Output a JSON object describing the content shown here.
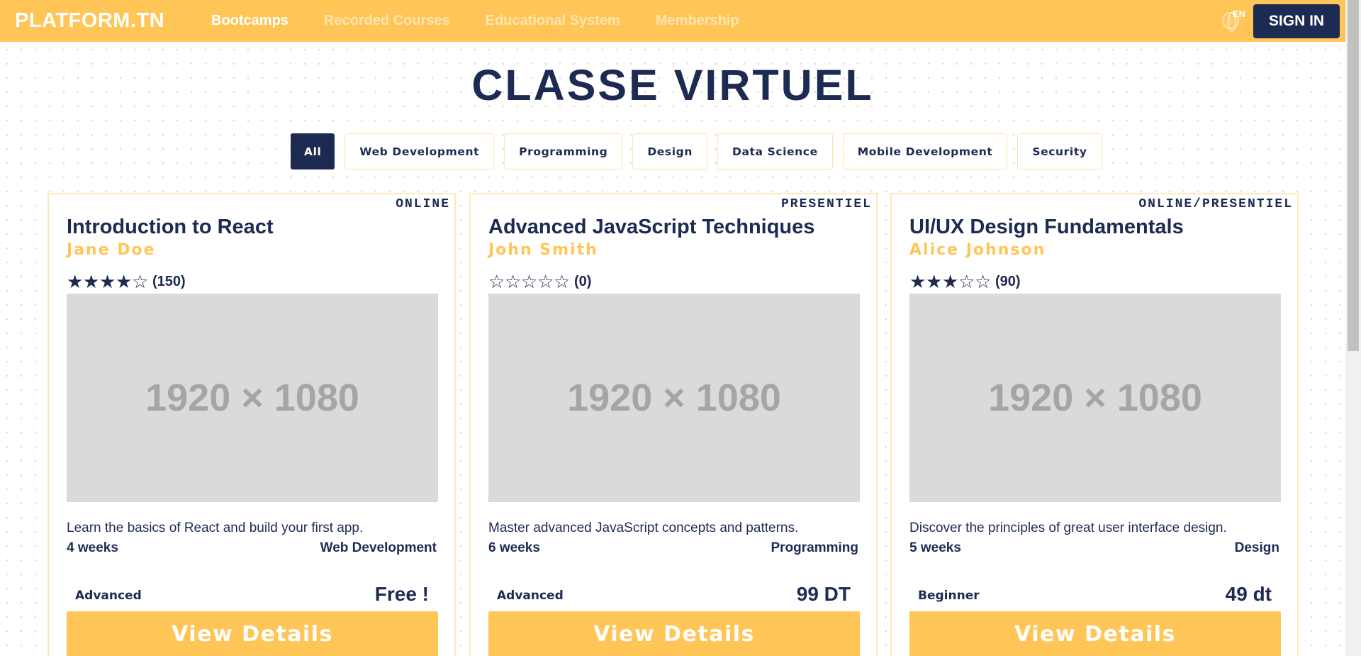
{
  "header": {
    "logo": "PLATFORM.TN",
    "nav": [
      "Bootcamps",
      "Recorded Courses",
      "Educational System",
      "Membership"
    ],
    "active_nav": "Bootcamps",
    "language": "EN",
    "sign_in": "SIGN IN"
  },
  "page": {
    "title": "CLASSE VIRTUEL"
  },
  "filters": {
    "items": [
      "All",
      "Web Development",
      "Programming",
      "Design",
      "Data Science",
      "Mobile Development",
      "Security"
    ],
    "active": "All"
  },
  "courses": [
    {
      "mode": "ONLINE",
      "title": "Introduction to React",
      "author": "Jane Doe",
      "rating": 4,
      "rating_count": "(150)",
      "image_placeholder": "1920 × 1080",
      "description": "Learn the basics of React and build your first app.",
      "duration": "4 weeks",
      "category": "Web Development",
      "level": "Advanced",
      "price": "Free !",
      "button": "View Details"
    },
    {
      "mode": "PRESENTIEL",
      "title": "Advanced JavaScript Techniques",
      "author": "John Smith",
      "rating": 0,
      "rating_count": "(0)",
      "image_placeholder": "1920 × 1080",
      "description": "Master advanced JavaScript concepts and patterns.",
      "duration": "6 weeks",
      "category": "Programming",
      "level": "Advanced",
      "price": "99 DT",
      "button": "View Details"
    },
    {
      "mode": "ONLINE/PRESENTIEL",
      "title": "UI/UX Design Fundamentals",
      "author": "Alice Johnson",
      "rating": 3,
      "rating_count": "(90)",
      "image_placeholder": "1920 × 1080",
      "description": "Discover the principles of great user interface design.",
      "duration": "5 weeks",
      "category": "Design",
      "level": "Beginner",
      "price": "49 dt",
      "button": "View Details"
    }
  ],
  "colors": {
    "brand_yellow": "#ffc556",
    "navy": "#1d2b53",
    "placeholder_gray": "#dadada"
  },
  "icons": {
    "language": "globe-icon",
    "star_filled": "star-filled-icon",
    "star_empty": "star-empty-icon"
  }
}
